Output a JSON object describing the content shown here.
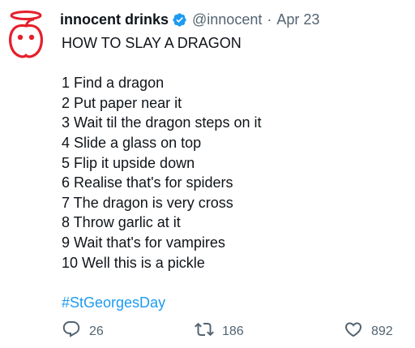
{
  "tweet": {
    "author_name": "innocent drinks",
    "handle": "@innocent",
    "separator": "·",
    "date": "Apr 23",
    "lines": [
      "HOW TO SLAY A DRAGON",
      "",
      "1 Find a dragon",
      "2 Put paper near it",
      "3 Wait til the dragon steps on it",
      "4 Slide a glass on top",
      "5 Flip it upside down",
      "6 Realise that's for spiders",
      "7 The dragon is very cross",
      "8 Throw garlic at it",
      "9 Wait that's for vampires",
      "10 Well this is a pickle",
      ""
    ],
    "hashtag": "#StGeorgesDay"
  },
  "actions": {
    "reply_count": "26",
    "retweet_count": "186",
    "like_count": "892"
  },
  "icons": {
    "avatar": "innocent-logo-icon",
    "verified": "verified-badge-icon",
    "reply": "reply-icon",
    "retweet": "retweet-icon",
    "like": "heart-icon"
  },
  "colors": {
    "brand_red": "#e4202b",
    "verified_blue": "#1d9bf0",
    "hashtag_blue": "#1d9bf0",
    "secondary_text": "#536471"
  }
}
